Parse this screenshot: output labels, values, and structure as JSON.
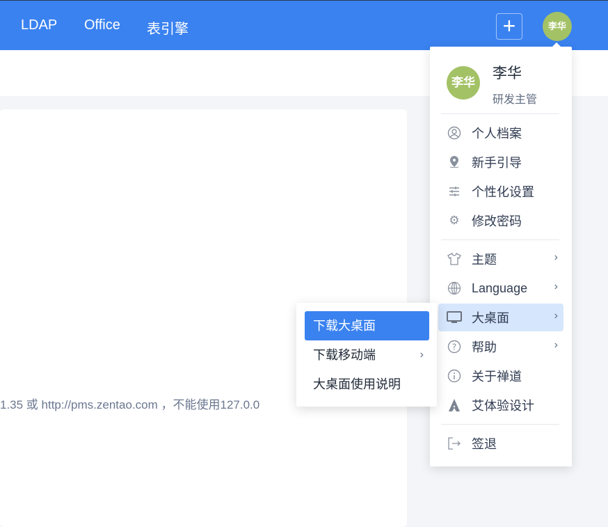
{
  "topbar": {
    "nav": [
      "LDAP",
      "Office",
      "表引擎"
    ],
    "add_label": "+",
    "avatar_text": "李华"
  },
  "content": {
    "hint": "1.35 或 http://pms.zentao.com ，不能使用127.0.0"
  },
  "user_menu": {
    "avatar_text": "李华",
    "name": "李华",
    "role": "研发主管",
    "items": [
      {
        "label": "个人档案",
        "icon": "user-circle-icon"
      },
      {
        "label": "新手引导",
        "icon": "map-pin-icon"
      },
      {
        "label": "个性化设置",
        "icon": "sliders-icon"
      },
      {
        "label": "修改密码",
        "icon": "gear-icon"
      },
      {
        "label": "主题",
        "icon": "tshirt-icon"
      },
      {
        "label": "Language",
        "icon": "globe-icon"
      },
      {
        "label": "大桌面",
        "icon": "monitor-icon"
      },
      {
        "label": "帮助",
        "icon": "help-circle-icon"
      },
      {
        "label": "关于禅道",
        "icon": "info-circle-icon"
      },
      {
        "label": "艾体验设计",
        "icon": "ai-logo-icon"
      },
      {
        "label": "签退",
        "icon": "logout-icon"
      }
    ]
  },
  "submenu": {
    "items": [
      "下载大桌面",
      "下载移动端",
      "大桌面使用说明"
    ]
  },
  "colors": {
    "primary": "#3a82f0",
    "avatar": "#a3c266",
    "active_bg": "#d6e6fc"
  }
}
